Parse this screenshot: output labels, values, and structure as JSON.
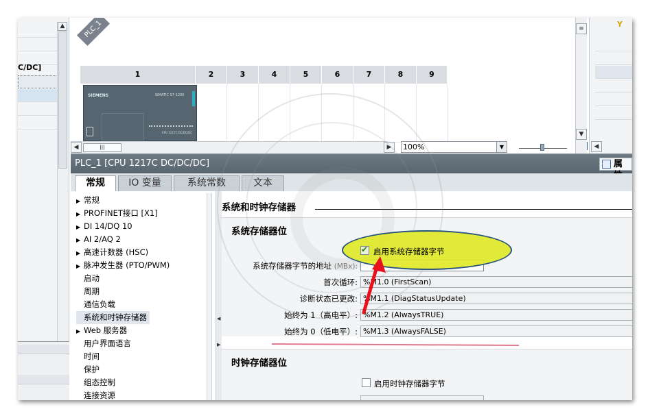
{
  "left_panel": {
    "fragment_text": "C/DC]"
  },
  "device_view": {
    "device_tag": "PLC_1",
    "slots": [
      "1",
      "2",
      "3",
      "4",
      "5",
      "6",
      "7",
      "8",
      "9"
    ],
    "cpu_brand": "SIEMENS",
    "cpu_model": "SIMATIC S7-1200",
    "cpu_sub": "CPU 1217C DC/DC/DC",
    "scroll_thumb": "|||",
    "zoom": "100%"
  },
  "right_panel": {
    "icon": "filter-icon"
  },
  "inspector": {
    "title": "PLC_1 [CPU 1217C DC/DC/DC]",
    "properties_button": "属性",
    "tabs": [
      "常规",
      "IO 变量",
      "系统常数",
      "文本"
    ],
    "active_tab": 0,
    "tree": [
      {
        "label": "常规",
        "expandable": true
      },
      {
        "label": "PROFINET接口 [X1]",
        "expandable": true
      },
      {
        "label": "DI 14/DQ 10",
        "expandable": true
      },
      {
        "label": "AI 2/AQ 2",
        "expandable": true
      },
      {
        "label": "高速计数器 (HSC)",
        "expandable": true
      },
      {
        "label": "脉冲发生器 (PTO/PWM)",
        "expandable": true
      },
      {
        "label": "启动",
        "expandable": false
      },
      {
        "label": "周期",
        "expandable": false
      },
      {
        "label": "通信负载",
        "expandable": false
      },
      {
        "label": "系统和时钟存储器",
        "expandable": false,
        "selected": true
      },
      {
        "label": "Web 服务器",
        "expandable": true
      },
      {
        "label": "用户界面语言",
        "expandable": false
      },
      {
        "label": "时间",
        "expandable": false
      },
      {
        "label": "保护",
        "expandable": false
      },
      {
        "label": "组态控制",
        "expandable": false
      },
      {
        "label": "连接资源",
        "expandable": false
      }
    ],
    "content": {
      "section_title": "系统和时钟存储器",
      "system_memory": {
        "heading": "系统存储器位",
        "enable_label": "启用系统存储器字节",
        "enabled": true,
        "address_label": "系统存储器字节的地址",
        "address_hint": "(MBx):",
        "address_value": "",
        "rows": [
          {
            "label": "首次循环:",
            "value": "%M1.0 (FirstScan)"
          },
          {
            "label": "诊断状态已更改:",
            "value": "%M1.1 (DiagStatusUpdate)"
          },
          {
            "label": "始终为 1（高电平）:",
            "value": "%M1.2 (AlwaysTRUE)"
          },
          {
            "label": "始终为 0（低电平）:",
            "value": "%M1.3 (AlwaysFALSE)"
          }
        ]
      },
      "clock_memory": {
        "heading": "时钟存储器位",
        "enable_label": "启用时钟存储器字节",
        "enabled": false
      }
    }
  },
  "colors": {
    "title_bar": "#5f6b75",
    "highlight": "#e1e828",
    "arrow": "#e8101a",
    "underline": "#e0788e"
  }
}
